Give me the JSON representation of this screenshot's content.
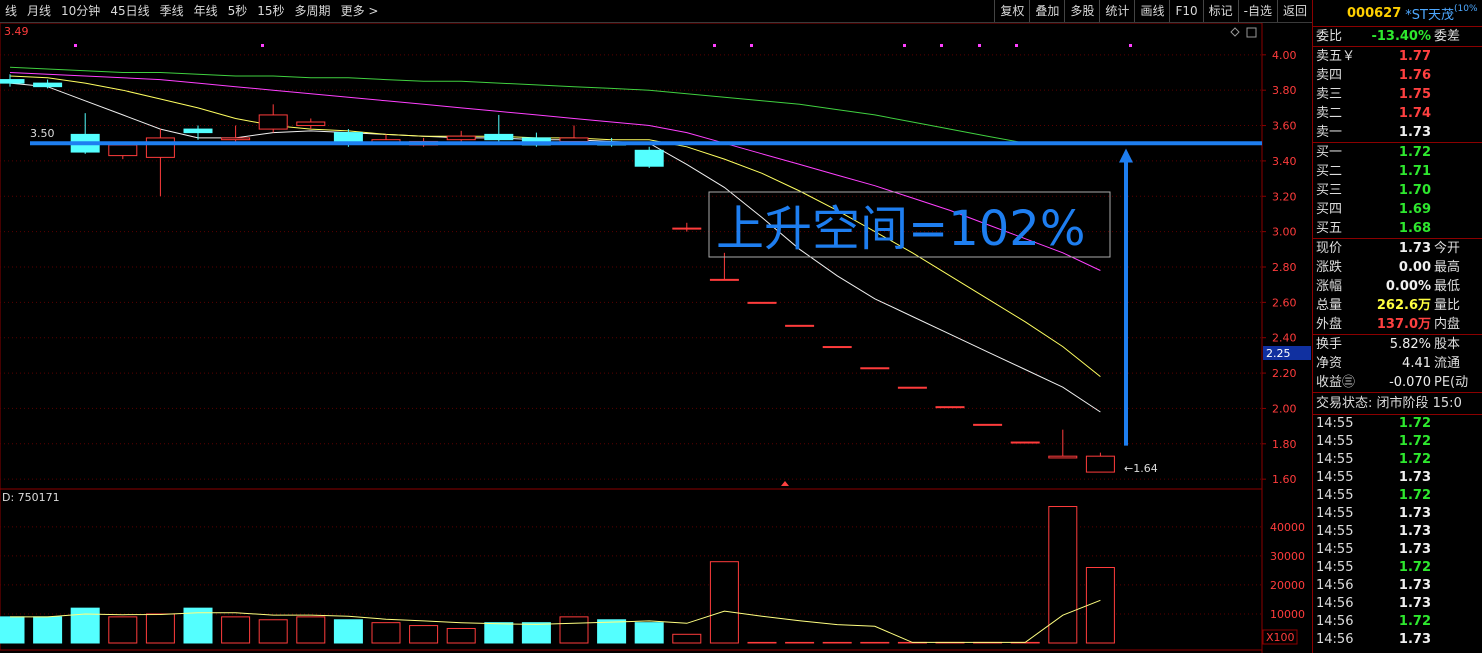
{
  "toolbar": {
    "periods": [
      "线",
      "月线",
      "10分钟",
      "45日线",
      "季线",
      "年线",
      "5秒",
      "15秒",
      "多周期",
      "更多 >"
    ],
    "buttons": [
      "复权",
      "叠加",
      "多股",
      "统计",
      "画线",
      "F10",
      "标记",
      "-自选",
      "返回"
    ]
  },
  "chart_data": {
    "type": "candlestick",
    "price_axis": {
      "ticks": [
        4.0,
        3.8,
        3.6,
        3.4,
        3.2,
        3.0,
        2.8,
        2.6,
        2.4,
        2.2,
        2.0,
        1.8,
        1.6
      ],
      "range": [
        1.55,
        4.18
      ]
    },
    "top_left_label": "3.49",
    "volume_label": "D: 750171",
    "volume_axis": {
      "ticks": [
        40000,
        30000,
        20000,
        10000
      ],
      "range": [
        0,
        52000
      ],
      "unit_label": "X100"
    },
    "current_price_tag": "2.25",
    "low_marker": "←1.64",
    "candles": [
      {
        "o": 3.86,
        "c": 3.84,
        "h": 3.89,
        "l": 3.82
      },
      {
        "o": 3.84,
        "c": 3.82,
        "h": 3.86,
        "l": 3.81
      },
      {
        "o": 3.55,
        "c": 3.45,
        "h": 3.67,
        "l": 3.44
      },
      {
        "o": 3.43,
        "c": 3.49,
        "h": 3.5,
        "l": 3.41
      },
      {
        "o": 3.42,
        "c": 3.53,
        "h": 3.58,
        "l": 3.2
      },
      {
        "o": 3.58,
        "c": 3.56,
        "h": 3.6,
        "l": 3.52
      },
      {
        "o": 3.52,
        "c": 3.53,
        "h": 3.6,
        "l": 3.5
      },
      {
        "o": 3.58,
        "c": 3.66,
        "h": 3.72,
        "l": 3.56
      },
      {
        "o": 3.6,
        "c": 3.62,
        "h": 3.64,
        "l": 3.58
      },
      {
        "o": 3.56,
        "c": 3.5,
        "h": 3.58,
        "l": 3.48
      },
      {
        "o": 3.5,
        "c": 3.52,
        "h": 3.55,
        "l": 3.49
      },
      {
        "o": 3.49,
        "c": 3.51,
        "h": 3.53,
        "l": 3.48
      },
      {
        "o": 3.52,
        "c": 3.54,
        "h": 3.57,
        "l": 3.5
      },
      {
        "o": 3.55,
        "c": 3.52,
        "h": 3.66,
        "l": 3.5
      },
      {
        "o": 3.53,
        "c": 3.49,
        "h": 3.56,
        "l": 3.48
      },
      {
        "o": 3.51,
        "c": 3.53,
        "h": 3.6,
        "l": 3.49
      },
      {
        "o": 3.5,
        "c": 3.49,
        "h": 3.53,
        "l": 3.48
      },
      {
        "o": 3.46,
        "c": 3.37,
        "h": 3.48,
        "l": 3.36
      },
      {
        "o": 3.02,
        "c": 3.02,
        "h": 3.05,
        "l": 3.0
      },
      {
        "o": 2.73,
        "c": 2.73,
        "h": 2.88,
        "l": 2.73
      },
      {
        "o": 2.6,
        "c": 2.6,
        "h": 2.6,
        "l": 2.6
      },
      {
        "o": 2.47,
        "c": 2.47,
        "h": 2.47,
        "l": 2.47
      },
      {
        "o": 2.35,
        "c": 2.35,
        "h": 2.35,
        "l": 2.35
      },
      {
        "o": 2.23,
        "c": 2.23,
        "h": 2.23,
        "l": 2.23
      },
      {
        "o": 2.12,
        "c": 2.12,
        "h": 2.12,
        "l": 2.12
      },
      {
        "o": 2.01,
        "c": 2.01,
        "h": 2.01,
        "l": 2.01
      },
      {
        "o": 1.91,
        "c": 1.91,
        "h": 1.91,
        "l": 1.91
      },
      {
        "o": 1.81,
        "c": 1.81,
        "h": 1.81,
        "l": 1.81
      },
      {
        "o": 1.72,
        "c": 1.73,
        "h": 1.88,
        "l": 1.72
      },
      {
        "o": 1.64,
        "c": 1.73,
        "h": 1.75,
        "l": 1.64
      }
    ],
    "volume": [
      9000,
      9000,
      12000,
      9000,
      10000,
      12000,
      9000,
      8000,
      9000,
      8000,
      7000,
      6000,
      5000,
      7000,
      7000,
      9000,
      8000,
      7000,
      3000,
      28000,
      200,
      200,
      200,
      200,
      200,
      200,
      200,
      200,
      47000,
      26000
    ],
    "ma_lines": [
      {
        "name": "MA5",
        "color": "#f0f0f0",
        "values": [
          3.84,
          3.82,
          3.74,
          3.66,
          3.58,
          3.53,
          3.53,
          3.56,
          3.57,
          3.56,
          3.55,
          3.54,
          3.53,
          3.53,
          3.52,
          3.52,
          3.51,
          3.5,
          3.38,
          3.25,
          3.08,
          2.9,
          2.75,
          2.62,
          2.52,
          2.42,
          2.32,
          2.22,
          2.12,
          1.98
        ]
      },
      {
        "name": "MA10",
        "color": "#ffff60",
        "values": [
          3.88,
          3.87,
          3.84,
          3.8,
          3.75,
          3.7,
          3.64,
          3.6,
          3.58,
          3.57,
          3.55,
          3.54,
          3.54,
          3.54,
          3.53,
          3.53,
          3.52,
          3.52,
          3.48,
          3.41,
          3.33,
          3.23,
          3.12,
          3.0,
          2.88,
          2.75,
          2.62,
          2.49,
          2.35,
          2.18
        ]
      },
      {
        "name": "MA20",
        "color": "#ff40ff",
        "values": [
          3.9,
          3.89,
          3.88,
          3.87,
          3.86,
          3.84,
          3.82,
          3.8,
          3.78,
          3.76,
          3.74,
          3.72,
          3.7,
          3.68,
          3.66,
          3.64,
          3.62,
          3.6,
          3.56,
          3.5,
          3.44,
          3.38,
          3.32,
          3.26,
          3.19,
          3.12,
          3.04,
          2.96,
          2.88,
          2.78
        ]
      },
      {
        "name": "MA60",
        "color": "#40d040",
        "values": [
          3.93,
          3.92,
          3.91,
          3.9,
          3.9,
          3.89,
          3.88,
          3.88,
          3.87,
          3.87,
          3.86,
          3.85,
          3.85,
          3.84,
          3.83,
          3.82,
          3.81,
          3.8,
          3.78,
          3.76,
          3.74,
          3.72,
          3.69,
          3.66,
          3.62,
          3.58,
          3.54,
          3.5
        ]
      }
    ],
    "annotation": {
      "text": "上升空间=102%",
      "level": 3.5,
      "level_label": "3.50",
      "arrow_from": 1.79,
      "arrow_to": 3.47,
      "color": "#1e7ef0"
    }
  },
  "panel": {
    "code": "000627",
    "name": "*ST天茂",
    "tag": "(10%",
    "weibi_label": "委比",
    "weibi": "-13.40%",
    "weicha_label": "委差",
    "asks": [
      {
        "label": "卖五￥",
        "price": "1.77"
      },
      {
        "label": "卖四",
        "price": "1.76"
      },
      {
        "label": "卖三",
        "price": "1.75"
      },
      {
        "label": "卖二",
        "price": "1.74"
      },
      {
        "label": "卖一",
        "price": "1.73"
      }
    ],
    "bids": [
      {
        "label": "买一",
        "price": "1.72"
      },
      {
        "label": "买二",
        "price": "1.71"
      },
      {
        "label": "买三",
        "price": "1.70"
      },
      {
        "label": "买四",
        "price": "1.69"
      },
      {
        "label": "买五",
        "price": "1.68"
      }
    ],
    "stats": [
      {
        "l1": "现价",
        "v": "1.73",
        "c": "white",
        "l2": "今开"
      },
      {
        "l1": "涨跌",
        "v": "0.00",
        "c": "white",
        "l2": "最高"
      },
      {
        "l1": "涨幅",
        "v": "0.00%",
        "c": "white",
        "l2": "最低"
      },
      {
        "l1": "总量",
        "v": "262.6万",
        "c": "yellow",
        "l2": "量比"
      },
      {
        "l1": "外盘",
        "v": "137.0万",
        "c": "red",
        "l2": "内盘"
      }
    ],
    "stats2": [
      {
        "l1": "换手",
        "v": "5.82%",
        "c": "white",
        "l2": "股本"
      },
      {
        "l1": "净资",
        "v": "4.41",
        "c": "white",
        "l2": "流通"
      },
      {
        "l1": "收益㊂",
        "v": "-0.070",
        "c": "white",
        "l2": "PE(动"
      }
    ],
    "status": "交易状态: 闭市阶段 15:0",
    "ticks": [
      {
        "t": "14:55",
        "p": "1.72",
        "c": "green"
      },
      {
        "t": "14:55",
        "p": "1.72",
        "c": "green"
      },
      {
        "t": "14:55",
        "p": "1.72",
        "c": "green"
      },
      {
        "t": "14:55",
        "p": "1.73",
        "c": "white"
      },
      {
        "t": "14:55",
        "p": "1.72",
        "c": "green"
      },
      {
        "t": "14:55",
        "p": "1.73",
        "c": "white"
      },
      {
        "t": "14:55",
        "p": "1.73",
        "c": "white"
      },
      {
        "t": "14:55",
        "p": "1.73",
        "c": "white"
      },
      {
        "t": "14:55",
        "p": "1.72",
        "c": "green"
      },
      {
        "t": "14:56",
        "p": "1.73",
        "c": "white"
      },
      {
        "t": "14:56",
        "p": "1.73",
        "c": "white"
      },
      {
        "t": "14:56",
        "p": "1.72",
        "c": "green"
      },
      {
        "t": "14:56",
        "p": "1.73",
        "c": "white"
      }
    ]
  }
}
